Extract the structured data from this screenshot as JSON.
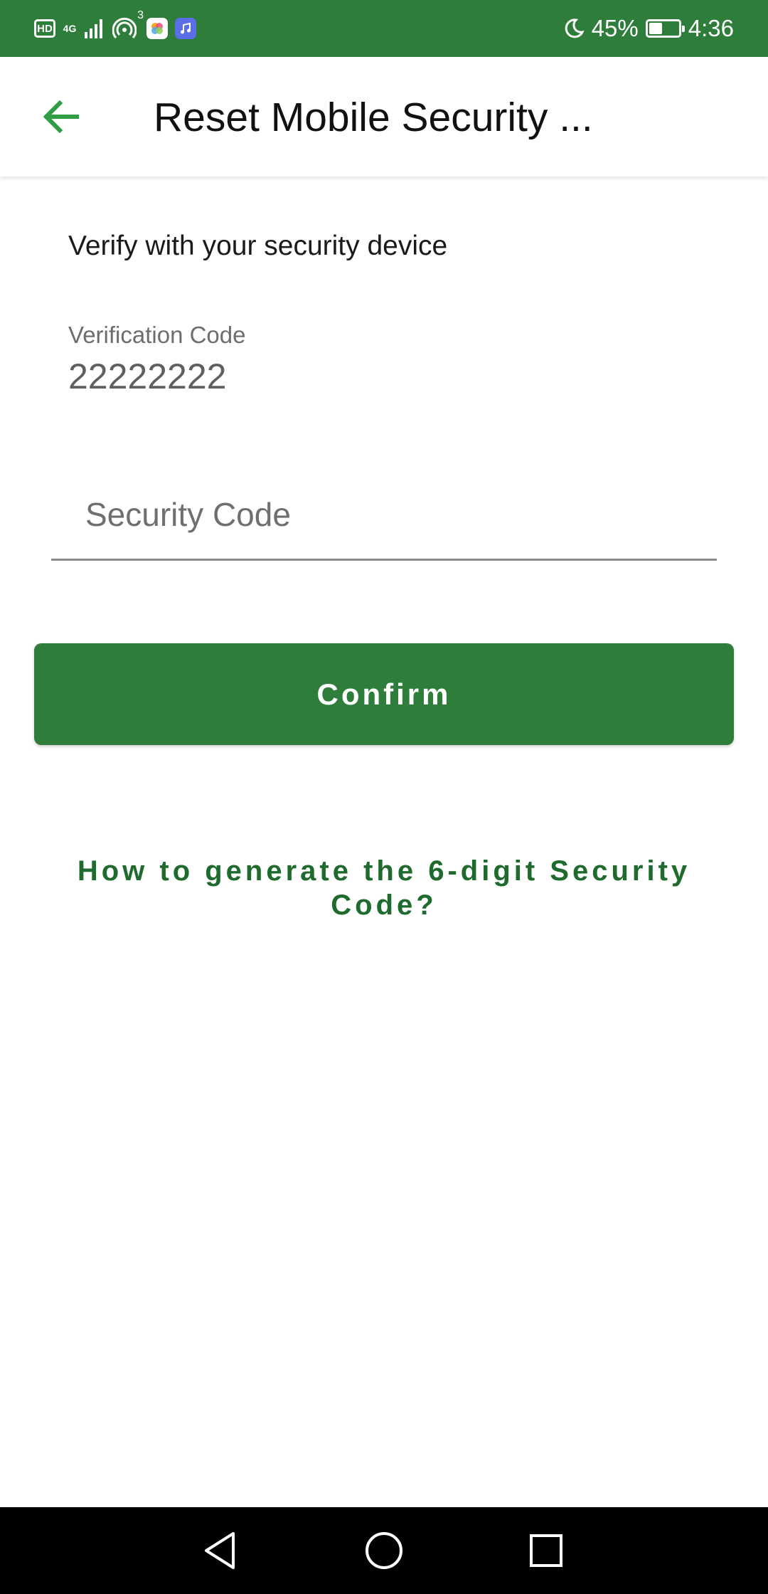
{
  "status_bar": {
    "hd_label": "HD",
    "network_label": "4G",
    "hotspot_count": "3",
    "battery_percent": "45%",
    "battery_level": 0.45,
    "time": "4:36",
    "icons": [
      "hd-icon",
      "signal-icon",
      "hotspot-icon",
      "app-icon-photos",
      "app-icon-music",
      "moon-icon",
      "battery-icon"
    ],
    "background": "#2e7d3a"
  },
  "app_bar": {
    "title": "Reset Mobile Security ...",
    "back_icon": "arrow-left-icon",
    "accent": "#2e9d44"
  },
  "content": {
    "subtitle": "Verify with your security device",
    "verification_label": "Verification Code",
    "verification_value": "22222222",
    "security_code_placeholder": "Security Code",
    "security_code_value": "",
    "confirm_label": "Confirm",
    "help_link": "How to generate the 6-digit Security Code?"
  },
  "nav_bar": {
    "icons": [
      "back-triangle-icon",
      "home-circle-icon",
      "recents-square-icon"
    ]
  }
}
